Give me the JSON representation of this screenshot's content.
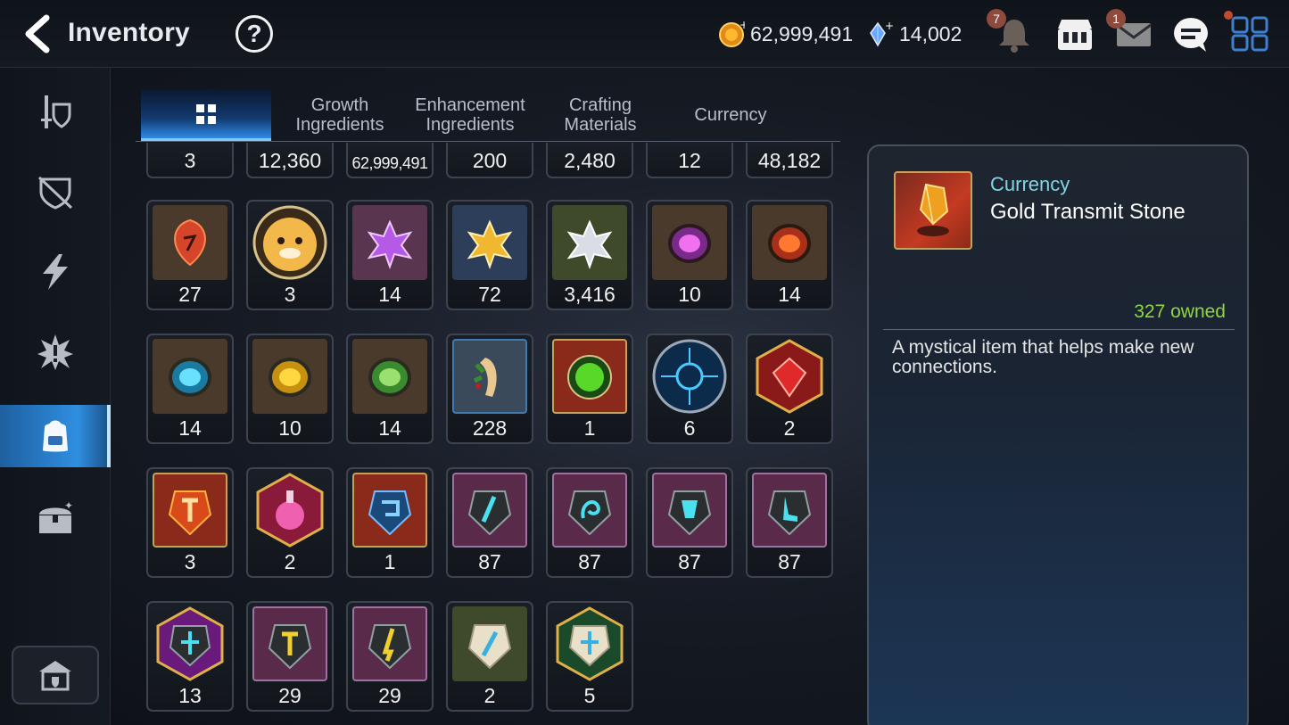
{
  "header": {
    "title": "Inventory",
    "help_label": "?",
    "gold": "62,999,491",
    "crystals": "14,002",
    "notification_count": "7",
    "mail_count": "1",
    "icons": [
      "back-arrow-icon",
      "help-icon",
      "gold-coin-icon",
      "crystal-icon",
      "bell-icon",
      "shop-icon",
      "mail-icon",
      "chat-icon",
      "menu-grid-icon"
    ]
  },
  "sidebar": {
    "items": [
      {
        "name": "equipment",
        "icon": "sword-shield-icon"
      },
      {
        "name": "artifacts",
        "icon": "broken-shield-icon"
      },
      {
        "name": "catalysts",
        "icon": "lightning-icon"
      },
      {
        "name": "specialty",
        "icon": "burst-icon"
      },
      {
        "name": "materials",
        "icon": "backpack-icon"
      },
      {
        "name": "storage",
        "icon": "chest-icon"
      }
    ],
    "active_index": 4,
    "bottom_icon": "guild-house-icon"
  },
  "tabs": [
    {
      "label": "",
      "icon": "grid-icon",
      "active": true
    },
    {
      "label": "Growth\nIngredients",
      "active": false
    },
    {
      "label": "Enhancement\nIngredients",
      "active": false
    },
    {
      "label": "Crafting\nMaterials",
      "active": false
    },
    {
      "label": "Currency",
      "active": false
    }
  ],
  "grid": {
    "row0": [
      "3",
      "12,360",
      "62,999,491",
      "200",
      "2,480",
      "12",
      "48,182"
    ],
    "row1": [
      "27",
      "3",
      "14",
      "72",
      "3,416",
      "10",
      "14"
    ],
    "row2": [
      "14",
      "10",
      "14",
      "228",
      "1",
      "6",
      "2"
    ],
    "row3": [
      "3",
      "2",
      "1",
      "87",
      "87",
      "87",
      "87"
    ],
    "row4": [
      "13",
      "29",
      "29",
      "2",
      "5"
    ]
  },
  "detail": {
    "category": "Currency",
    "name": "Gold Transmit Stone",
    "owned": "327 owned",
    "description": "A mystical item that helps make new connections."
  },
  "colors": {
    "accent": "#2f8fe0",
    "owned_green": "#8fd640",
    "category_cyan": "#7fd6e6"
  }
}
